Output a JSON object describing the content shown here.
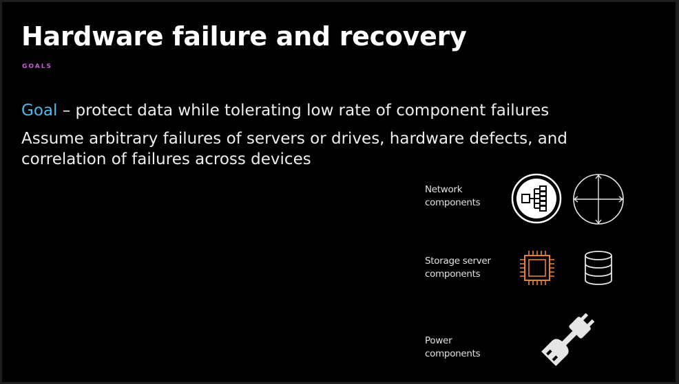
{
  "slide": {
    "title": "Hardware failure and recovery",
    "subtitle": "GOALS",
    "goal_keyword": "Goal",
    "goal_text": " – protect data while tolerating low rate of component failures",
    "assume_text": "Assume arbitrary failures of servers or drives, hardware defects, and correlation of failures across devices"
  },
  "components": [
    {
      "line1": "Network",
      "line2": "components",
      "icons": [
        "network-switch-icon",
        "router-icon"
      ]
    },
    {
      "line1": "Storage server",
      "line2": "components",
      "icons": [
        "cpu-chip-icon",
        "database-icon"
      ]
    },
    {
      "line1": "Power",
      "line2": "components",
      "icons": [
        "power-plug-icon"
      ]
    }
  ],
  "colors": {
    "background": "#000000",
    "goal_accent": "#4fb8e8",
    "subtitle_accent": "#c55fd6",
    "chip_icon": "#e8822a"
  }
}
